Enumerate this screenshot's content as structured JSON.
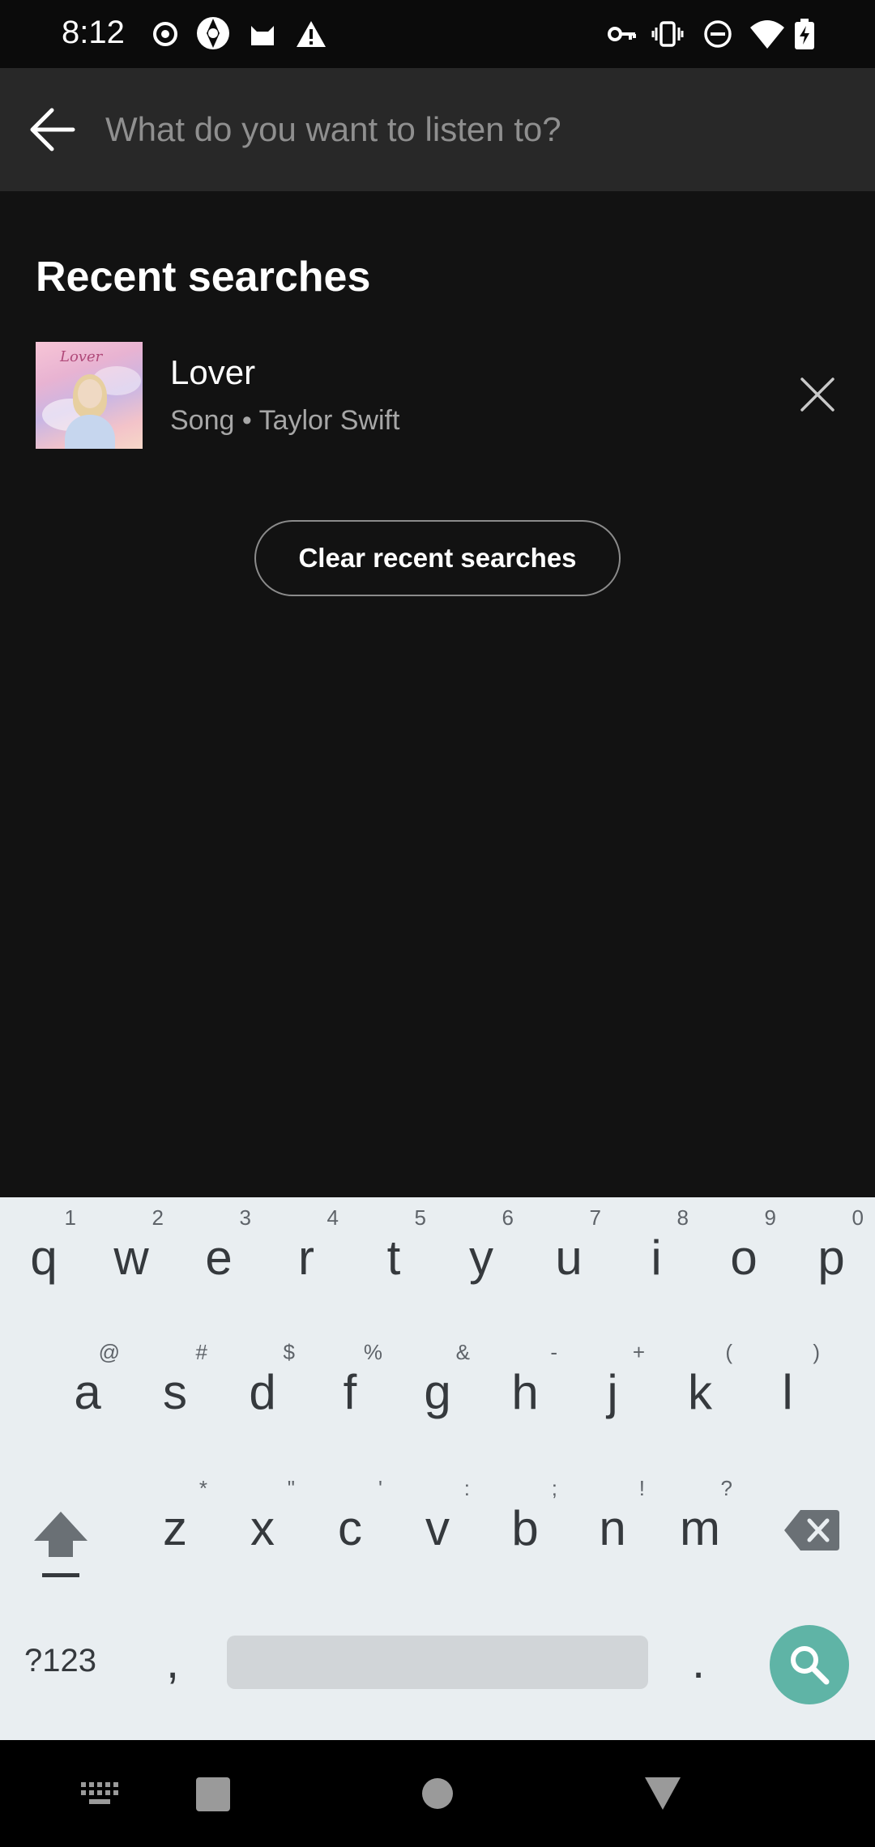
{
  "status_bar": {
    "time": "8:12",
    "left_icons": [
      "record-icon",
      "aperture-icon",
      "cat-icon",
      "warning-icon"
    ],
    "right_icons": [
      "vpn-key-icon",
      "vibrate-icon",
      "do-not-disturb-icon",
      "wifi-icon",
      "battery-charging-icon"
    ]
  },
  "search": {
    "placeholder": "What do you want to listen to?",
    "value": ""
  },
  "recent": {
    "title": "Recent searches",
    "items": [
      {
        "title": "Lover",
        "subtitle": "Song • Taylor Swift",
        "art_script": "Lover"
      }
    ],
    "clear_label": "Clear recent searches"
  },
  "keyboard": {
    "rows": [
      [
        {
          "key": "q",
          "hint": "1"
        },
        {
          "key": "w",
          "hint": "2"
        },
        {
          "key": "e",
          "hint": "3"
        },
        {
          "key": "r",
          "hint": "4"
        },
        {
          "key": "t",
          "hint": "5"
        },
        {
          "key": "y",
          "hint": "6"
        },
        {
          "key": "u",
          "hint": "7"
        },
        {
          "key": "i",
          "hint": "8"
        },
        {
          "key": "o",
          "hint": "9"
        },
        {
          "key": "p",
          "hint": "0"
        }
      ],
      [
        {
          "key": "a",
          "hint": "@"
        },
        {
          "key": "s",
          "hint": "#"
        },
        {
          "key": "d",
          "hint": "$"
        },
        {
          "key": "f",
          "hint": "%"
        },
        {
          "key": "g",
          "hint": "&"
        },
        {
          "key": "h",
          "hint": "-"
        },
        {
          "key": "j",
          "hint": "+"
        },
        {
          "key": "k",
          "hint": "("
        },
        {
          "key": "l",
          "hint": ")"
        }
      ],
      [
        {
          "key": "z",
          "hint": "*"
        },
        {
          "key": "x",
          "hint": "\""
        },
        {
          "key": "c",
          "hint": "'"
        },
        {
          "key": "v",
          "hint": ":"
        },
        {
          "key": "b",
          "hint": ";"
        },
        {
          "key": "n",
          "hint": "!"
        },
        {
          "key": "m",
          "hint": "?"
        }
      ]
    ],
    "symbols_label": "?123",
    "comma": ",",
    "period": ".",
    "search_key_color": "#5fb4a6"
  },
  "nav_bar": {
    "icons": [
      "keyboard-icon",
      "recents-icon",
      "home-icon",
      "back-icon"
    ]
  },
  "colors": {
    "background": "#121212",
    "header": "#282828",
    "keyboard": "#e9eef1"
  }
}
